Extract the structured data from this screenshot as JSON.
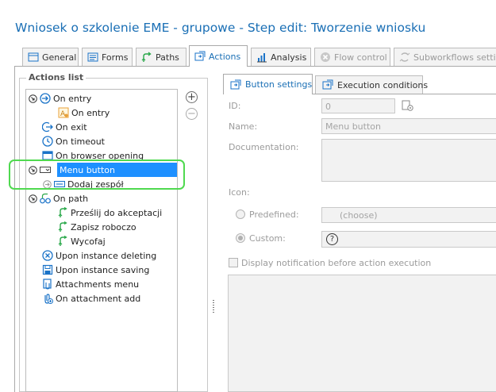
{
  "window": {
    "title": "Wniosek o szkolenie EME - grupowe - Step edit: Tworzenie wniosku"
  },
  "tabs": [
    {
      "label": "General",
      "icon": "general-icon",
      "state": "normal"
    },
    {
      "label": "Forms",
      "icon": "forms-icon",
      "state": "normal"
    },
    {
      "label": "Paths",
      "icon": "paths-icon",
      "state": "normal"
    },
    {
      "label": "Actions",
      "icon": "actions-icon",
      "state": "active"
    },
    {
      "label": "Analysis",
      "icon": "analysis-icon",
      "state": "normal"
    },
    {
      "label": "Flow control",
      "icon": "flow-control-icon",
      "state": "disabled"
    },
    {
      "label": "Subworkflows setting",
      "icon": "subworkflows-icon",
      "state": "disabled"
    }
  ],
  "actions_list": {
    "title": "Actions list",
    "items": [
      {
        "label": "On entry",
        "icon": "on-entry-icon",
        "expander": "collapse"
      },
      {
        "label": "On entry",
        "icon": "form-action-icon"
      },
      {
        "label": "On exit",
        "icon": "on-exit-icon"
      },
      {
        "label": "On timeout",
        "icon": "clock-icon"
      },
      {
        "label": "On browser opening",
        "icon": "browser-icon"
      },
      {
        "label": "Menu button",
        "icon": "menu-button-icon",
        "expander": "collapse",
        "selected": true
      },
      {
        "label": "Dodaj zespół",
        "icon": "button-icon",
        "expander": "arrow"
      },
      {
        "label": "On path",
        "icon": "on-path-icon",
        "expander": "collapse"
      },
      {
        "label": "Prześlij do akceptacji",
        "icon": "path-icon"
      },
      {
        "label": "Zapisz roboczo",
        "icon": "path-icon"
      },
      {
        "label": "Wycofaj",
        "icon": "path-icon"
      },
      {
        "label": "Upon instance deleting",
        "icon": "delete-icon"
      },
      {
        "label": "Upon instance saving",
        "icon": "save-icon"
      },
      {
        "label": "Attachments menu",
        "icon": "attachments-menu-icon"
      },
      {
        "label": "On attachment add",
        "icon": "attachment-add-icon"
      }
    ],
    "add_symbol": "+",
    "remove_symbol": "−"
  },
  "inner_tabs": [
    {
      "label": "Button settings",
      "icon": "button-settings-icon",
      "state": "active"
    },
    {
      "label": "Execution conditions",
      "icon": "execution-conditions-icon",
      "state": "normal"
    }
  ],
  "button_settings": {
    "id_label": "ID:",
    "id_value": "0",
    "name_label": "Name:",
    "name_value": "Menu button",
    "documentation_label": "Documentation:",
    "documentation_value": "",
    "icon_label": "Icon:",
    "predefined_label": "Predefined:",
    "predefined_value": "(choose)",
    "custom_label": "Custom:",
    "custom_icon_symbol": "?",
    "custom_selected": true,
    "display_notification_label": "Display notification before action execution",
    "display_notification_checked": false
  },
  "colors": {
    "title": "#1a6fb5",
    "selection": "#1e90ff",
    "highlight": "#4fd94f",
    "icon_blue": "#1a73c8",
    "path_green": "#2aa84a",
    "disabled_text": "#9b9b9b"
  }
}
